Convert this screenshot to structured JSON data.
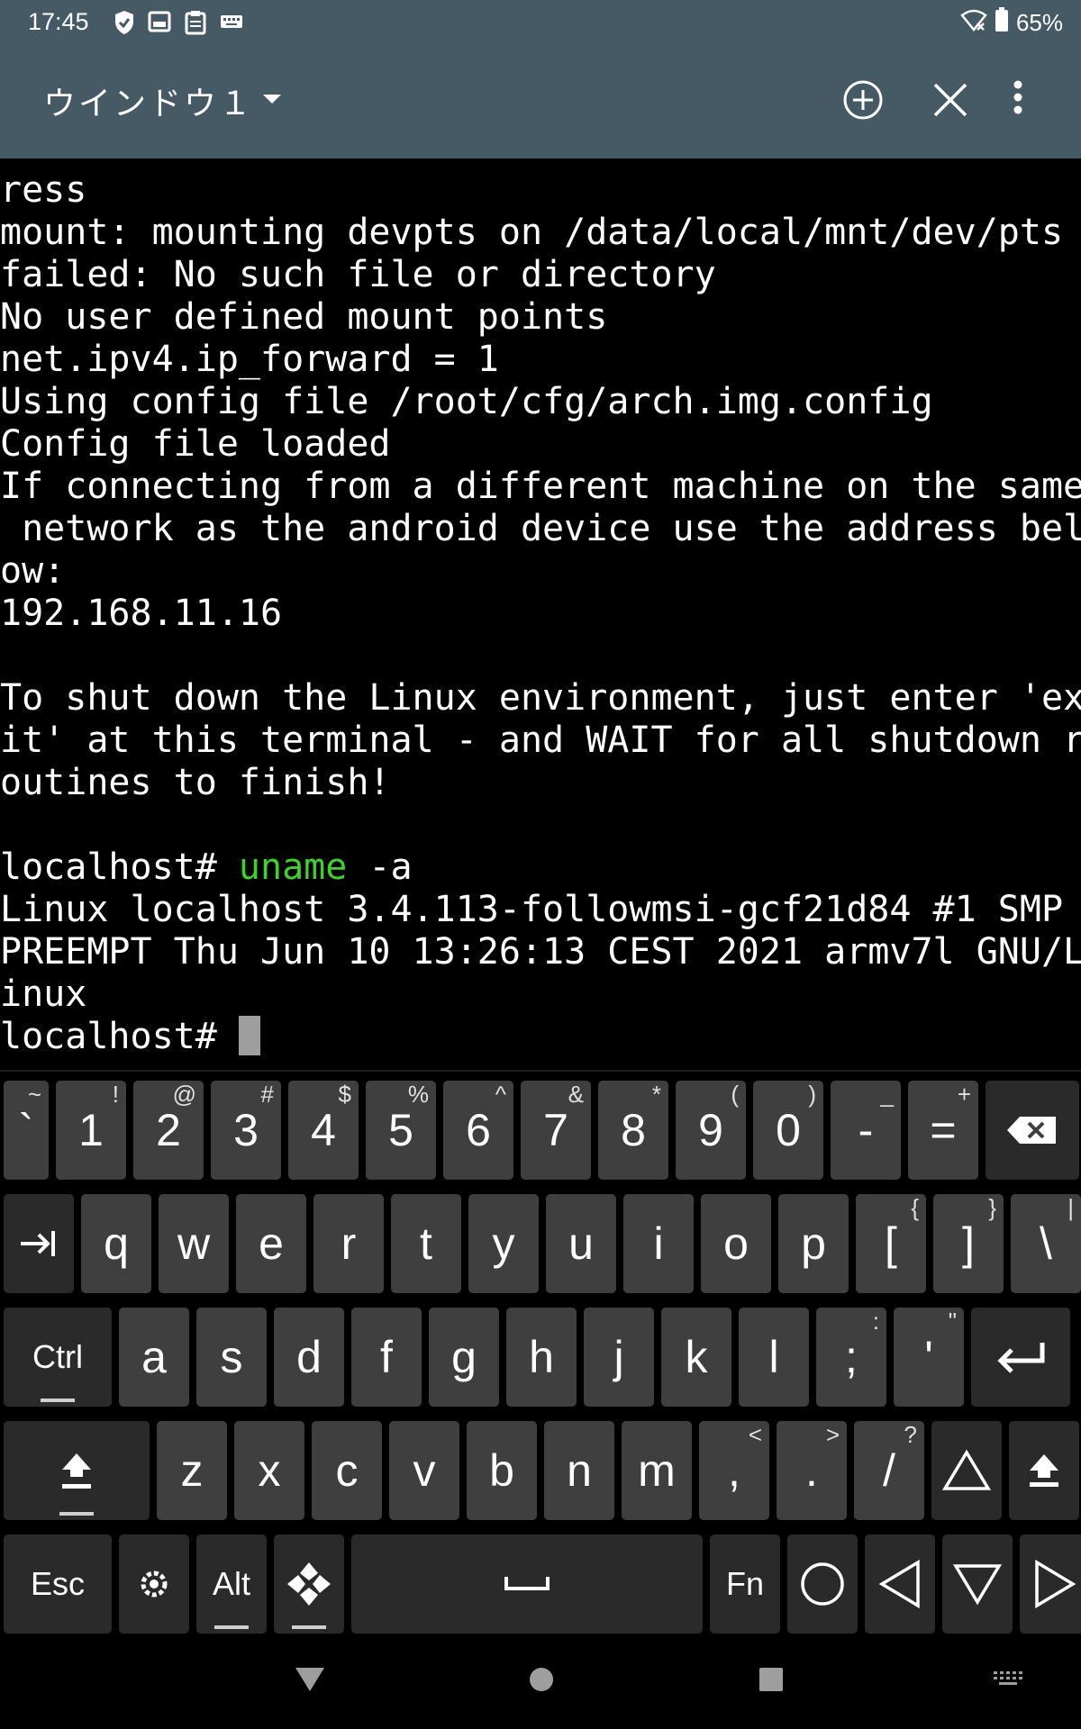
{
  "status_bar": {
    "time": "17:45",
    "battery": "65%"
  },
  "app_bar": {
    "window_title": "ウインドウ１"
  },
  "terminal": {
    "lines": [
      {
        "text": "ress"
      },
      {
        "text": "mount: mounting devpts on /data/local/mnt/dev/pts"
      },
      {
        "text": "failed: No such file or directory"
      },
      {
        "text": "No user defined mount points"
      },
      {
        "text": "net.ipv4.ip_forward = 1"
      },
      {
        "text": "Using config file /root/cfg/arch.img.config"
      },
      {
        "text": "Config file loaded"
      },
      {
        "text": "If connecting from a different machine on the same"
      },
      {
        "text": " network as the android device use the address bel"
      },
      {
        "text": "ow:"
      },
      {
        "text": "192.168.11.16"
      },
      {
        "text": ""
      },
      {
        "text": "To shut down the Linux environment, just enter 'ex"
      },
      {
        "text": "it' at this terminal - and WAIT for all shutdown r"
      },
      {
        "text": "outines to finish!"
      },
      {
        "text": ""
      },
      {
        "prompt": "localhost# ",
        "cmd": "uname",
        "args": " -a"
      },
      {
        "text": "Linux localhost 3.4.113-followmsi-gcf21d84 #1 SMP "
      },
      {
        "text": "PREEMPT Thu Jun 10 13:26:13 CEST 2021 armv7l GNU/L"
      },
      {
        "text": "inux"
      },
      {
        "prompt": "localhost# ",
        "cursor": true
      }
    ]
  },
  "keyboard": {
    "rows": [
      [
        {
          "main": "`",
          "sub": "~"
        },
        {
          "main": "1",
          "sub": "!"
        },
        {
          "main": "2",
          "sub": "@"
        },
        {
          "main": "3",
          "sub": "#"
        },
        {
          "main": "4",
          "sub": "$"
        },
        {
          "main": "5",
          "sub": "%"
        },
        {
          "main": "6",
          "sub": "^"
        },
        {
          "main": "7",
          "sub": "&"
        },
        {
          "main": "8",
          "sub": "*"
        },
        {
          "main": "9",
          "sub": "("
        },
        {
          "main": "0",
          "sub": ")"
        },
        {
          "main": "-",
          "sub": "_"
        },
        {
          "main": "=",
          "sub": "+"
        },
        {
          "icon": "backspace-icon"
        }
      ],
      [
        {
          "icon": "tab-icon"
        },
        {
          "main": "q"
        },
        {
          "main": "w"
        },
        {
          "main": "e"
        },
        {
          "main": "r"
        },
        {
          "main": "t"
        },
        {
          "main": "y"
        },
        {
          "main": "u"
        },
        {
          "main": "i"
        },
        {
          "main": "o"
        },
        {
          "main": "p"
        },
        {
          "main": "[",
          "sub": "{"
        },
        {
          "main": "]",
          "sub": "}"
        },
        {
          "main": "\\",
          "sub": "|"
        }
      ],
      [
        {
          "main": "Ctrl"
        },
        {
          "main": "a"
        },
        {
          "main": "s"
        },
        {
          "main": "d"
        },
        {
          "main": "f"
        },
        {
          "main": "g"
        },
        {
          "main": "h"
        },
        {
          "main": "j"
        },
        {
          "main": "k"
        },
        {
          "main": "l"
        },
        {
          "main": ";",
          "sub": ":"
        },
        {
          "main": "'",
          "sub": "\""
        },
        {
          "icon": "enter-icon"
        }
      ],
      [
        {
          "icon": "shift-icon"
        },
        {
          "main": "z"
        },
        {
          "main": "x"
        },
        {
          "main": "c"
        },
        {
          "main": "v"
        },
        {
          "main": "b"
        },
        {
          "main": "n"
        },
        {
          "main": "m"
        },
        {
          "main": ",",
          "sub": "<"
        },
        {
          "main": ".",
          "sub": ">"
        },
        {
          "main": "/",
          "sub": "?"
        },
        {
          "icon": "arrow-up-icon"
        },
        {
          "icon": "shift-right-icon"
        }
      ],
      [
        {
          "main": "Esc"
        },
        {
          "icon": "settings-icon"
        },
        {
          "main": "Alt"
        },
        {
          "icon": "dpad-icon"
        },
        {
          "icon": "space-icon"
        },
        {
          "main": "Fn"
        },
        {
          "icon": "circle-icon"
        },
        {
          "icon": "arrow-left-icon"
        },
        {
          "icon": "arrow-down-icon"
        },
        {
          "icon": "arrow-right-icon"
        }
      ]
    ]
  },
  "nav_bar": {
    "icons": [
      "back-icon",
      "home-icon",
      "recents-icon",
      "keyboard-switch-icon"
    ]
  },
  "colors": {
    "app_bar": "#455a64",
    "terminal_bg": "#000000",
    "terminal_fg": "#ffffff",
    "command": "#3fd12c",
    "key_bg": "#3f3f3f",
    "key_dark_bg": "#2a2a2a"
  }
}
